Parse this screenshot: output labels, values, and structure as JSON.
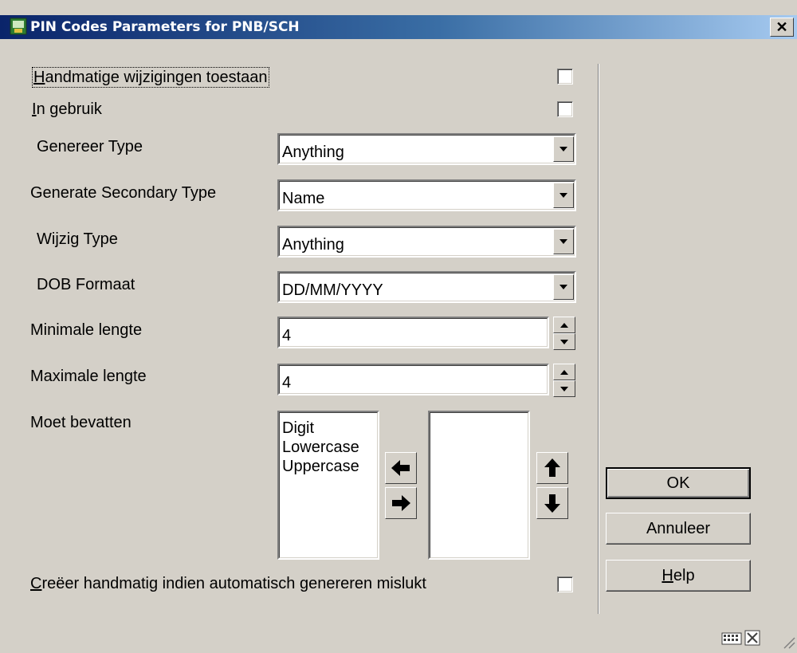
{
  "window": {
    "title": "PIN Codes Parameters for PNB/SCH",
    "close_glyph": "✕"
  },
  "checkboxes": {
    "manual_changes": {
      "label_mnemonic": "H",
      "label_rest": "andmatige wijzigingen toestaan",
      "checked": false
    },
    "in_use": {
      "label_mnemonic": "I",
      "label_rest": "n gebruik",
      "checked": false
    },
    "create_manual": {
      "label_mnemonic": "C",
      "label_rest": "reëer handmatig indien automatisch genereren mislukt",
      "checked": false
    }
  },
  "fields": {
    "generate_type": {
      "label": "Genereer Type",
      "value": "Anything"
    },
    "secondary_type": {
      "label": "Generate Secondary Type",
      "value": "Name"
    },
    "change_type": {
      "label": "Wijzig Type",
      "value": "Anything"
    },
    "dob_format": {
      "label": "DOB Formaat",
      "value": "DD/MM/YYYY"
    },
    "min_length": {
      "label": "Minimale lengte",
      "value": "4"
    },
    "max_length": {
      "label": "Maximale lengte",
      "value": "4"
    }
  },
  "must_contain": {
    "label": "Moet bevatten",
    "available": [
      "Digit",
      "Lowercase",
      "Uppercase"
    ],
    "selected": []
  },
  "buttons": {
    "ok": "OK",
    "cancel": "Annuleer",
    "help_mnemonic": "H",
    "help_rest": "elp"
  },
  "icons": [
    "app-icon",
    "close-icon",
    "arrow-left-icon",
    "arrow-right-icon",
    "arrow-up-icon",
    "arrow-down-icon",
    "keyboard-icon",
    "resize-icon",
    "size-grip-icon"
  ],
  "colors": {
    "face": "#d4d0c8",
    "title_start": "#0a246a",
    "title_end": "#a6caf0"
  }
}
